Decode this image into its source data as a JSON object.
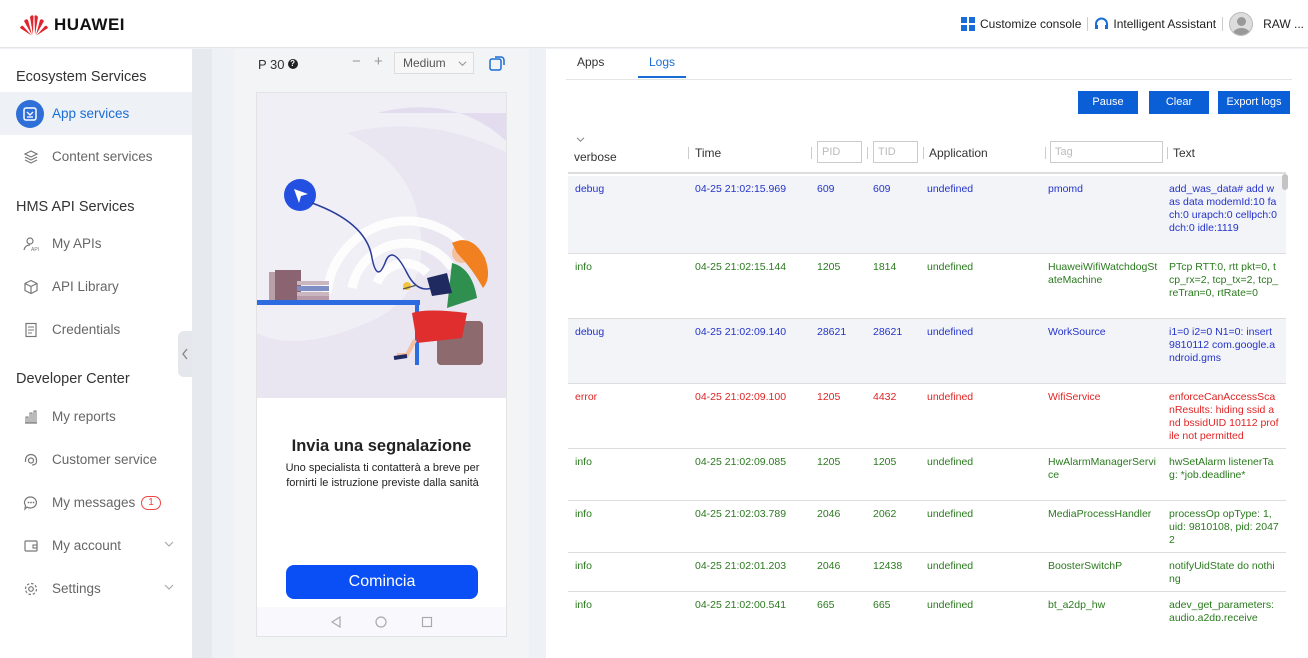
{
  "header": {
    "brand": "HUAWEI",
    "customize_console": "Customize console",
    "assistant": "Intelligent Assistant",
    "user": "RAW ..."
  },
  "sidebar": {
    "sections": [
      {
        "title": "Ecosystem Services",
        "items": [
          {
            "label": "App services",
            "icon": "app-grid-icon",
            "active": true
          },
          {
            "label": "Content services",
            "icon": "layers-icon"
          }
        ]
      },
      {
        "title": "HMS API Services",
        "items": [
          {
            "label": "My APIs",
            "icon": "api-user-icon"
          },
          {
            "label": "API Library",
            "icon": "cube-icon"
          },
          {
            "label": "Credentials",
            "icon": "document-icon"
          }
        ]
      },
      {
        "title": "Developer Center",
        "items": [
          {
            "label": "My reports",
            "icon": "bar-chart-icon"
          },
          {
            "label": "Customer service",
            "icon": "headset-icon"
          },
          {
            "label": "My messages",
            "icon": "chat-icon",
            "badge": "1"
          },
          {
            "label": "My account",
            "icon": "wallet-icon",
            "expandable": true
          },
          {
            "label": "Settings",
            "icon": "gear-icon",
            "expandable": true
          }
        ]
      }
    ]
  },
  "device": {
    "model": "P 30",
    "zoom_out": "−",
    "zoom_in": "+",
    "size": "Medium",
    "screen": {
      "title": "Invia una segnalazione",
      "subtitle": "Uno specialista ti contatterà a breve per fornirti le istruzione previste dalla sanità",
      "button": "Comincia"
    }
  },
  "logs": {
    "tabs": [
      "Apps",
      "Logs"
    ],
    "active_tab": "Logs",
    "buttons": {
      "pause": "Pause",
      "clear": "Clear",
      "export": "Export logs"
    },
    "level_filter": "verbose",
    "columns": {
      "time": "Time",
      "pid_placeholder": "PID",
      "tid_placeholder": "TID",
      "application": "Application",
      "tag_placeholder": "Tag",
      "text": "Text"
    },
    "rows": [
      {
        "level": "debug",
        "time": "04-25 21:02:15.969",
        "pid": "609",
        "tid": "609",
        "app": "undefined",
        "tag": "pmomd",
        "text": "add_was_data# add was data modemId:10 fach:0 urapch:0 cellpch:0 dch:0 idle:1119"
      },
      {
        "level": "info",
        "time": "04-25 21:02:15.144",
        "pid": "1205",
        "tid": "1814",
        "app": "undefined",
        "tag": "HuaweiWifiWatchdogStateMachine",
        "text": "PTcp RTT:0, rtt pkt=0, tcp_rx=2, tcp_tx=2, tcp_reTran=0, rtRate=0"
      },
      {
        "level": "debug",
        "time": "04-25 21:02:09.140",
        "pid": "28621",
        "tid": "28621",
        "app": "undefined",
        "tag": "WorkSource",
        "text": "i1=0 i2=0 N1=0: insert 9810112 com.google.android.gms"
      },
      {
        "level": "error",
        "time": "04-25 21:02:09.100",
        "pid": "1205",
        "tid": "4432",
        "app": "undefined",
        "tag": "WifiService",
        "text": "enforceCanAccessScanResults: hiding ssid and bssidUID 10112 profile not permitted"
      },
      {
        "level": "info",
        "time": "04-25 21:02:09.085",
        "pid": "1205",
        "tid": "1205",
        "app": "undefined",
        "tag": "HwAlarmManagerService",
        "text": "hwSetAlarm listenerTag: *job.deadline*"
      },
      {
        "level": "info",
        "time": "04-25 21:02:03.789",
        "pid": "2046",
        "tid": "2062",
        "app": "undefined",
        "tag": "MediaProcessHandler",
        "text": "processOp opType: 1, uid: 9810108, pid: 20472"
      },
      {
        "level": "info",
        "time": "04-25 21:02:01.203",
        "pid": "2046",
        "tid": "12438",
        "app": "undefined",
        "tag": "BoosterSwitchP",
        "text": "notifyUidState do nothing"
      },
      {
        "level": "info",
        "time": "04-25 21:02:00.541",
        "pid": "665",
        "tid": "665",
        "app": "undefined",
        "tag": "bt_a2dp_hw",
        "text": "adev_get_parameters: audio.a2dp.receive"
      }
    ]
  }
}
